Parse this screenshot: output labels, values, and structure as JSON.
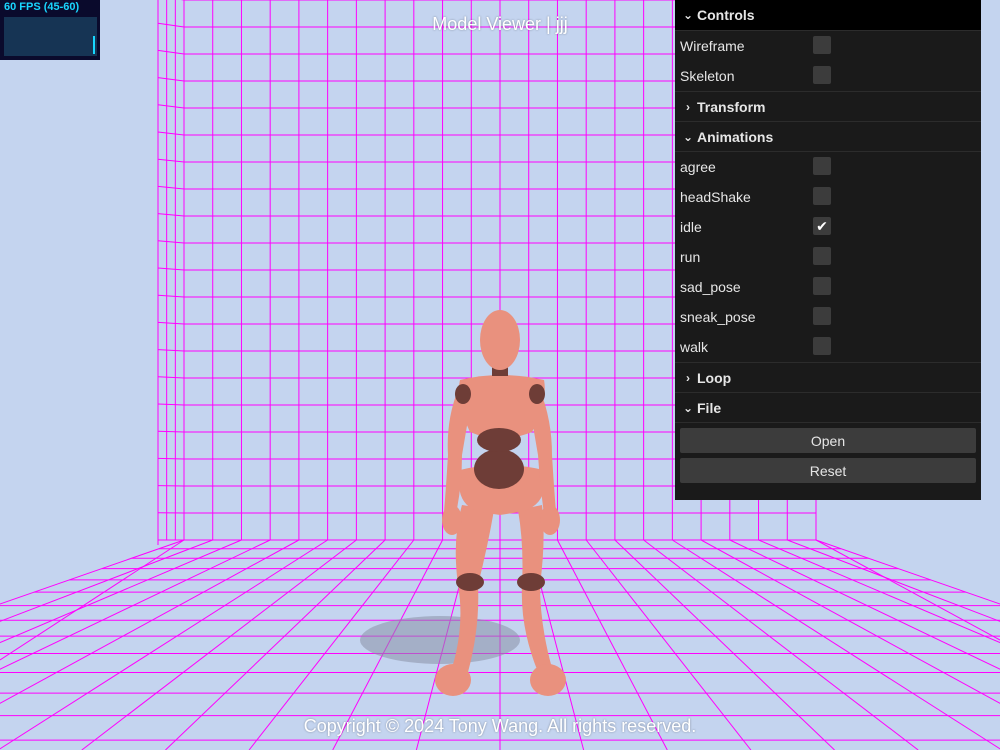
{
  "app": {
    "title": "Model Viewer | jjj",
    "copyright": "Copyright © 2024 Tony Wang. All rights reserved."
  },
  "stats": {
    "fps_label": "60 FPS (45-60)"
  },
  "colors": {
    "background": "#c4d4ef",
    "grid": "#ff00ff",
    "skin": "#e9917e",
    "joint": "#6e3d37",
    "panel_bg": "#1a1a1a",
    "stats_text": "#19d6ff"
  },
  "panel": {
    "title": "Controls",
    "display": [
      {
        "label": "Wireframe",
        "checked": false
      },
      {
        "label": "Skeleton",
        "checked": false
      }
    ],
    "transform": {
      "label": "Transform",
      "expanded": false
    },
    "animations": {
      "label": "Animations",
      "expanded": true,
      "items": [
        {
          "label": "agree",
          "checked": false
        },
        {
          "label": "headShake",
          "checked": false
        },
        {
          "label": "idle",
          "checked": true
        },
        {
          "label": "run",
          "checked": false
        },
        {
          "label": "sad_pose",
          "checked": false
        },
        {
          "label": "sneak_pose",
          "checked": false
        },
        {
          "label": "walk",
          "checked": false
        }
      ]
    },
    "loop": {
      "label": "Loop",
      "expanded": false
    },
    "file": {
      "label": "File",
      "expanded": true,
      "buttons": {
        "open": "Open",
        "reset": "Reset"
      }
    }
  }
}
